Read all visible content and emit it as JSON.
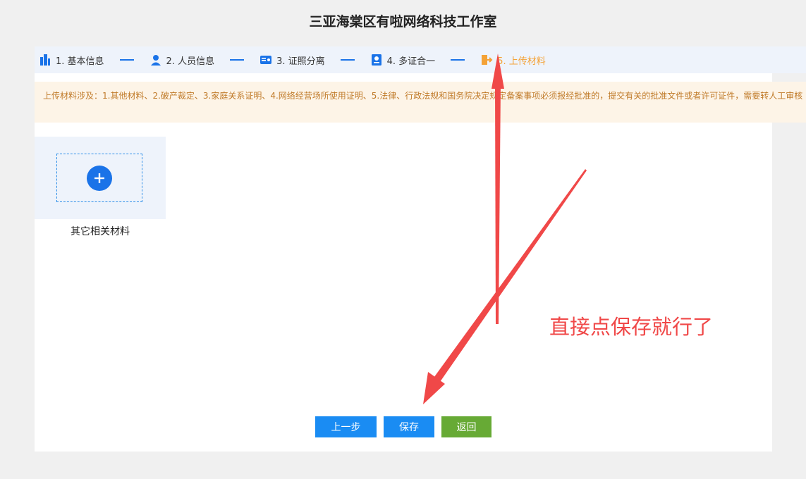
{
  "header": {
    "title": "三亚海棠区有啦网络科技工作室"
  },
  "steps": [
    {
      "label": "1. 基本信息",
      "icon": "building-icon"
    },
    {
      "label": "2. 人员信息",
      "icon": "person-icon"
    },
    {
      "label": "3. 证照分离",
      "icon": "id-card-icon"
    },
    {
      "label": "4. 多证合一",
      "icon": "certificate-icon"
    },
    {
      "label": "5. 上传材料",
      "icon": "upload-door-icon",
      "active": true
    }
  ],
  "notice": {
    "text": "上传材料涉及：1.其他材料、2.破产裁定、3.家庭关系证明、4.网络经营场所使用证明、5.法律、行政法规和国务院决定规定备案事项必须报经批准的，提交有关的批准文件或者许可证件，需要转人工审核"
  },
  "upload": {
    "label": "其它相关材料",
    "icon": "plus-icon"
  },
  "buttons": {
    "prev": "上一步",
    "save": "保存",
    "back": "返回"
  },
  "annotation": {
    "text": "直接点保存就行了"
  },
  "colors": {
    "primary": "#1a8cf3",
    "active_step": "#f4a236",
    "back_button": "#67aa35",
    "annotation": "#f04848",
    "notice_text": "#c07a28"
  }
}
